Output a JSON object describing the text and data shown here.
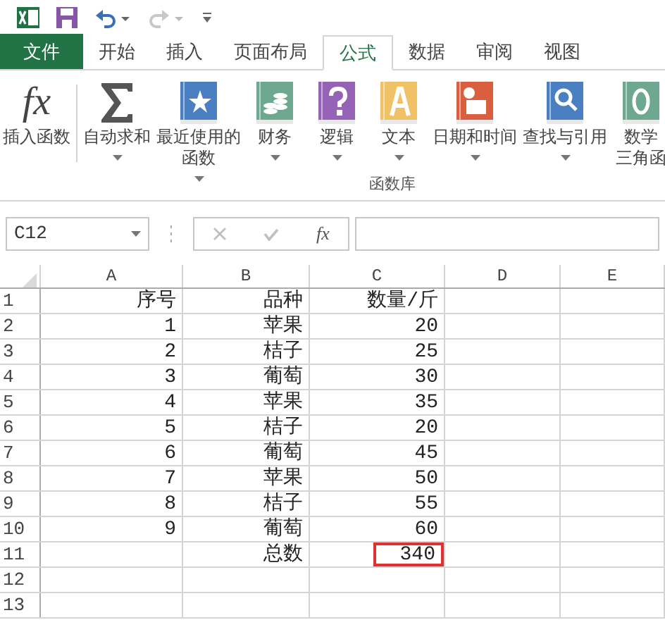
{
  "quick_access": {
    "undo_enabled": true,
    "redo_enabled": false
  },
  "tabs": [
    {
      "label": "文件",
      "kind": "file",
      "selected": false
    },
    {
      "label": "开始",
      "kind": "tab",
      "selected": false
    },
    {
      "label": "插入",
      "kind": "tab",
      "selected": false
    },
    {
      "label": "页面布局",
      "kind": "tab",
      "selected": false
    },
    {
      "label": "公式",
      "kind": "tab",
      "selected": true
    },
    {
      "label": "数据",
      "kind": "tab",
      "selected": false
    },
    {
      "label": "审阅",
      "kind": "tab",
      "selected": false
    },
    {
      "label": "视图",
      "kind": "tab",
      "selected": false
    }
  ],
  "ribbon": {
    "group_label": "函数库",
    "items": [
      {
        "kind": "fx",
        "glyph": "fx",
        "lines": [
          "插入函数"
        ],
        "dropdown": false
      },
      {
        "kind": "sigma",
        "lines": [
          "自动求和"
        ],
        "dropdown": true
      },
      {
        "kind": "star",
        "color": "#4a7fc1",
        "lines": [
          "最近使用的",
          "函数"
        ],
        "dropdown": true
      },
      {
        "kind": "coins",
        "color": "#6fa891",
        "lines": [
          "财务"
        ],
        "dropdown": true
      },
      {
        "kind": "question",
        "color": "#9463b5",
        "lines": [
          "逻辑"
        ],
        "dropdown": true
      },
      {
        "kind": "letter",
        "color": "#f0c265",
        "lines": [
          "文本"
        ],
        "dropdown": true
      },
      {
        "kind": "calendar",
        "color": "#d95f3e",
        "lines": [
          "日期和时间"
        ],
        "dropdown": true
      },
      {
        "kind": "search",
        "color": "#4a7fc1",
        "lines": [
          "查找与引用"
        ],
        "dropdown": true
      },
      {
        "kind": "theta",
        "color": "#6fa891",
        "lines": [
          "数学",
          "三角函"
        ],
        "dropdown": false
      }
    ]
  },
  "formula_bar": {
    "name_box": "C12",
    "fx": "fx"
  },
  "sheet": {
    "columns": [
      "A",
      "B",
      "C",
      "D",
      "E"
    ],
    "rows": [
      {
        "number": "1",
        "cells": [
          {
            "text": "序号",
            "marked": false
          },
          {
            "text": "品种",
            "marked": false
          },
          {
            "text": "数量/斤",
            "marked": false
          }
        ]
      },
      {
        "number": "2",
        "cells": [
          {
            "text": "1",
            "marked": false
          },
          {
            "text": "苹果",
            "marked": false
          },
          {
            "text": "20",
            "marked": false
          }
        ]
      },
      {
        "number": "3",
        "cells": [
          {
            "text": "2",
            "marked": false
          },
          {
            "text": "桔子",
            "marked": false
          },
          {
            "text": "25",
            "marked": false
          }
        ]
      },
      {
        "number": "4",
        "cells": [
          {
            "text": "3",
            "marked": false
          },
          {
            "text": "葡萄",
            "marked": false
          },
          {
            "text": "30",
            "marked": false
          }
        ]
      },
      {
        "number": "5",
        "cells": [
          {
            "text": "4",
            "marked": false
          },
          {
            "text": "苹果",
            "marked": false
          },
          {
            "text": "35",
            "marked": false
          }
        ]
      },
      {
        "number": "6",
        "cells": [
          {
            "text": "5",
            "marked": false
          },
          {
            "text": "桔子",
            "marked": false
          },
          {
            "text": "20",
            "marked": false
          }
        ]
      },
      {
        "number": "7",
        "cells": [
          {
            "text": "6",
            "marked": false
          },
          {
            "text": "葡萄",
            "marked": false
          },
          {
            "text": "45",
            "marked": false
          }
        ]
      },
      {
        "number": "8",
        "cells": [
          {
            "text": "7",
            "marked": false
          },
          {
            "text": "苹果",
            "marked": false
          },
          {
            "text": "50",
            "marked": false
          }
        ]
      },
      {
        "number": "9",
        "cells": [
          {
            "text": "8",
            "marked": false
          },
          {
            "text": "桔子",
            "marked": false
          },
          {
            "text": "55",
            "marked": false
          }
        ]
      },
      {
        "number": "10",
        "cells": [
          {
            "text": "9",
            "marked": false
          },
          {
            "text": "葡萄",
            "marked": false
          },
          {
            "text": "60",
            "marked": false
          }
        ]
      },
      {
        "number": "11",
        "cells": [
          {
            "marked": false
          },
          {
            "text": "总数",
            "marked": false
          },
          {
            "text": "340",
            "marked": true
          }
        ]
      },
      {
        "number": "12",
        "cells": []
      },
      {
        "number": "13",
        "cells": []
      }
    ]
  }
}
